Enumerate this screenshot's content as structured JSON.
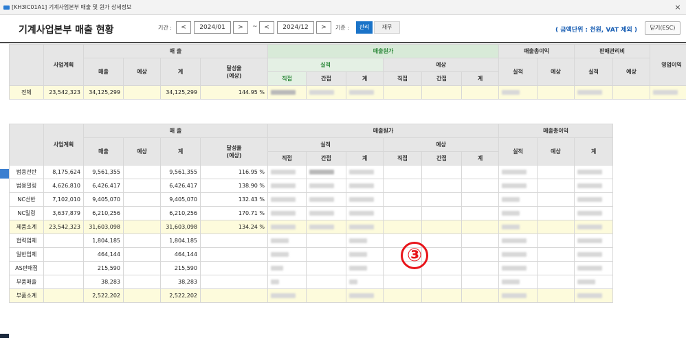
{
  "window": {
    "title": "[KH3IC01A1] 기계사업본부 매출 및 원가 상세정보",
    "close_glyph": "×"
  },
  "toolbar": {
    "page_title": "기계사업본부 매출 현황",
    "period_label": "기간 :",
    "prev_glyph": "<",
    "next_glyph": ">",
    "start_date": "2024/01",
    "end_date": "2024/12",
    "tilde": "~",
    "basis_label": "기준 :",
    "basis_options": [
      "관리",
      "재무"
    ],
    "basis_selected": "관리",
    "unit_note": "( 금액단위 : 천원, VAT 제외 )",
    "close_button": "닫기(ESC)"
  },
  "colors": {
    "accent_blue": "#1a73c8",
    "highlight_row": "#fdfbdc",
    "header_gray": "#e6e6e6",
    "header_green": "#d8ead8",
    "annotation_red": "#e8141a"
  },
  "summary_table": {
    "headers": {
      "plan": "사업계획",
      "sales_group": "매 출",
      "sales": "매출",
      "forecast": "예상",
      "total": "계",
      "achievement": "달성율",
      "achievement_sub": "(예상)",
      "cost_group": "매출원가",
      "actual": "실적",
      "expected": "예상",
      "direct": "직접",
      "indirect": "간접",
      "gross_profit": "매출총이익",
      "sga": "판매관리비",
      "operating_profit": "영업이익"
    },
    "row": {
      "label": "전체",
      "plan": "23,542,323",
      "sales": "34,125,299",
      "forecast": "",
      "total": "34,125,299",
      "achievement": "144.95 %"
    }
  },
  "detail_table": {
    "headers": {
      "plan": "사업계획",
      "sales_group": "매 출",
      "sales": "매출",
      "forecast": "예상",
      "total": "계",
      "achievement": "달성율",
      "achievement_sub": "(예상)",
      "cost_group": "매출원가",
      "actual": "실적",
      "expected": "예상",
      "direct": "직접",
      "indirect": "간접",
      "gross_profit": "매출총이익"
    },
    "rows": [
      {
        "label": "범용선반",
        "plan": "8,175,624",
        "sales": "9,561,355",
        "forecast": "",
        "total": "9,561,355",
        "achievement": "116.95 %"
      },
      {
        "label": "범용밀링",
        "plan": "4,626,810",
        "sales": "6,426,417",
        "forecast": "",
        "total": "6,426,417",
        "achievement": "138.90 %"
      },
      {
        "label": "NC선반",
        "plan": "7,102,010",
        "sales": "9,405,070",
        "forecast": "",
        "total": "9,405,070",
        "achievement": "132.43 %"
      },
      {
        "label": "NC밀링",
        "plan": "3,637,879",
        "sales": "6,210,256",
        "forecast": "",
        "total": "6,210,256",
        "achievement": "170.71 %"
      },
      {
        "label": "제품소계",
        "plan": "23,542,323",
        "sales": "31,603,098",
        "forecast": "",
        "total": "31,603,098",
        "achievement": "134.24 %"
      },
      {
        "label": "협력업체",
        "plan": "",
        "sales": "1,804,185",
        "forecast": "",
        "total": "1,804,185",
        "achievement": ""
      },
      {
        "label": "일반업체",
        "plan": "",
        "sales": "464,144",
        "forecast": "",
        "total": "464,144",
        "achievement": ""
      },
      {
        "label": "AS판매점",
        "plan": "",
        "sales": "215,590",
        "forecast": "",
        "total": "215,590",
        "achievement": ""
      },
      {
        "label": "부품매출",
        "plan": "",
        "sales": "38,283",
        "forecast": "",
        "total": "38,283",
        "achievement": ""
      },
      {
        "label": "부품소계",
        "plan": "",
        "sales": "2,522,202",
        "forecast": "",
        "total": "2,522,202",
        "achievement": ""
      }
    ]
  },
  "annotation": {
    "marker": "③"
  }
}
